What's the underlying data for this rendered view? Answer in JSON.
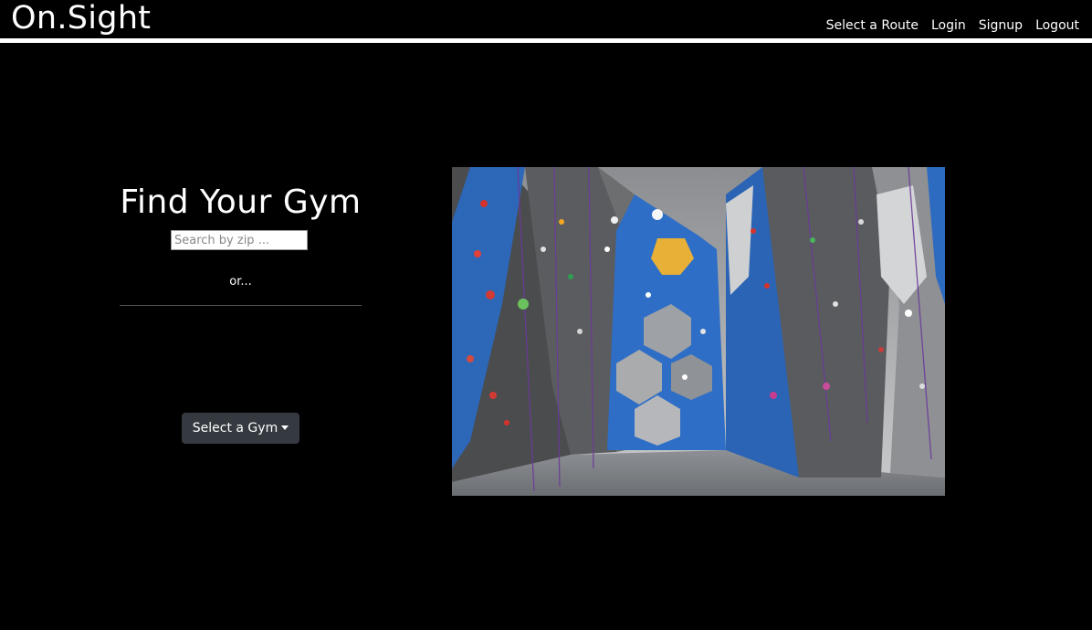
{
  "navbar": {
    "brand": "On.Sight",
    "links": [
      "Select a Route",
      "Login",
      "Signup",
      "Logout"
    ]
  },
  "search": {
    "title": "Find Your Gym",
    "placeholder": "Search by zip ...",
    "or_text": "or..."
  },
  "gym_select": {
    "label": "Select a Gym"
  },
  "colors": {
    "background": "#000000",
    "dropdown_bg": "#343a40",
    "wall_blue": "#2b6cc4",
    "wall_grey": "#5f6062"
  }
}
